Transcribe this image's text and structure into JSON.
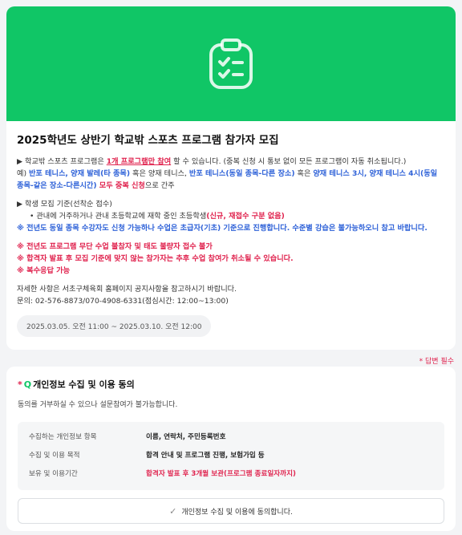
{
  "hero": {
    "icon": "clipboard-checklist-icon",
    "bg_color": "#10c666"
  },
  "notice": {
    "title": "2025학년도 상반기 학교밖 스포츠 프로그램 참가자 모집",
    "p1_a": "▶ 학교밖 스포츠 프로그램은 ",
    "p1_b": "1개 프로그램만 참여",
    "p1_c": " 할 수 있습니다. (중복 신청 시 통보 없이 모든 프로그램이 자동 취소됩니다.)",
    "p2_a": "예) ",
    "p2_b": "반포 테니스, 양재 발레(타 종목)",
    "p2_c": " 혹은 양재 테니스, ",
    "p2_d": "반포 테니스(동일 종목-다른 장소)",
    "p2_e": " 혹은 ",
    "p2_f": "양재 테니스 3시, 양재 테니스 4시(동일",
    "p3_a": "종목-같은 장소-다른시간)",
    "p3_b": "  모두 중복 신청",
    "p3_c": "으로 간주",
    "p4": "▶ 학생 모집 기준(선착순 접수)",
    "p5_a": "•  관내에 거주하거나 관내 초등학교에 재학 중인 초등학생",
    "p5_b": "(신규, 재접수 구분 없음)",
    "p6": "※ 전년도 동일 종목 수강자도 신청 가능하나 수업은 초급자(기초) 기준으로 진행합니다. 수준별 강습은 불가능하오니 참고 바랍니다.",
    "p7": "※ 전년도 프로그램 무단 수업 불참자 및 태도 불량자 접수 불가",
    "p8": "※ 합격자 발표 후 모집 기준에 맞지 않는 참가자는 추후 수업 참여가 취소될 수 있습니다.",
    "p9": "※ 복수응답 가능",
    "p10": "자세한 사항은 서초구체육회 홈페이지 공지사항을 참고하시기 바랍니다.",
    "p11": "문의: 02-576-8873/070-4908-6331(점심시간: 12:00~13:00)",
    "period": "2025.03.05. 오전 11:00 ~ 2025.03.10. 오전 12:00"
  },
  "required_note": "* 답변 필수",
  "consent": {
    "star": "*",
    "q": "Q",
    "title": "개인정보 수집 및 이용 동의",
    "desc": "동의를 거부하실 수 있으나 설문참여가 불가능합니다.",
    "rows": [
      {
        "k": "수집하는 개인정보 항목",
        "v": "이름, 연락처, 주민등록번호"
      },
      {
        "k": "수집 및 이용 목적",
        "v": "합격 안내 및 프로그램 진행, 보험가입 등"
      },
      {
        "k": "보유 및 이용기간",
        "v": "합격자 발표 후 3개월 보관(프로그램 종료일자까지)"
      }
    ],
    "agree_label": "개인정보 수집 및 이용에 동의합니다."
  }
}
